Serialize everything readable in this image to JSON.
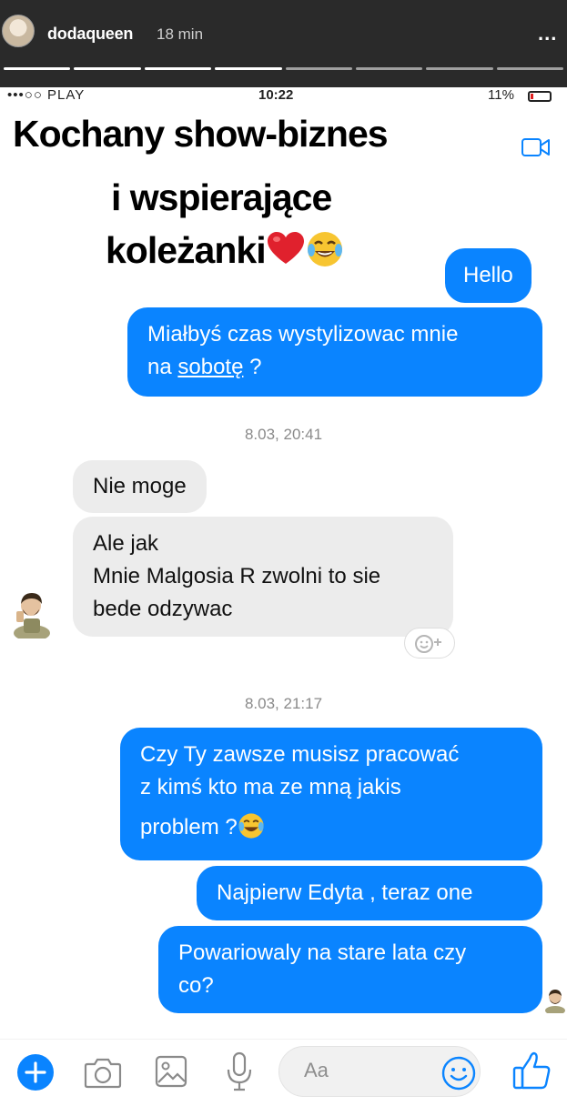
{
  "story": {
    "username": "dodaqueen",
    "time": "18 min",
    "more": "...",
    "progress_segments": 8,
    "active_segment_index": 3
  },
  "phone_status": {
    "carrier": "•••○○ PLAY",
    "time": "10:22",
    "battery": "11%"
  },
  "caption": {
    "line1": "Kochany show-biznes",
    "line2": "i wspierające",
    "line3": "koleżanki"
  },
  "messages": {
    "m1": "Hello",
    "m2_a": "Miałbyś czas wystylizowac mnie",
    "m2_b_pre": "na ",
    "m2_b_link": "sobotę",
    "m2_b_post": " ?",
    "ts1": "8.03, 20:41",
    "m3": "Nie moge",
    "m4_a": "Ale jak",
    "m4_b": "Mnie Malgosia R zwolni to sie",
    "m4_c": "bede odzywac",
    "ts2": "8.03, 21:17",
    "m5_a": "Czy Ty zawsze musisz pracować",
    "m5_b": "z kimś kto ma ze mną jakis",
    "m5_c": "problem ?",
    "m6": "Najpierw Edyta , teraz one",
    "m7_a": "Powariowaly na stare lata czy",
    "m7_b": "co?"
  },
  "composer": {
    "placeholder": "Aa"
  },
  "icons": [
    "plus-icon",
    "camera-icon",
    "image-icon",
    "microphone-icon",
    "emoji-icon",
    "thumbs-up-icon",
    "video-call-icon",
    "heart-emoji",
    "tears-of-joy-emoji",
    "add-reaction-icon"
  ],
  "colors": {
    "outgoing_bubble": "#0a84ff",
    "incoming_bubble": "#ececec",
    "story_header": "#2a2a2a",
    "accent": "#0a84ff"
  }
}
